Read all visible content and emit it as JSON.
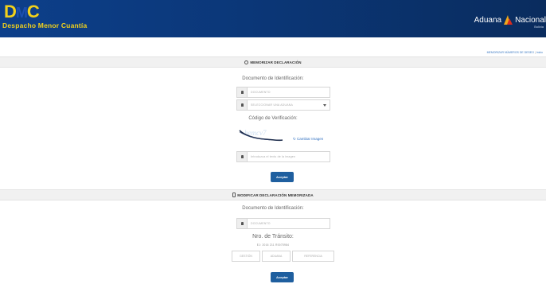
{
  "header": {
    "logo_letters": [
      "D",
      "M",
      "C"
    ],
    "logo_subtitle": "Despacho Menor Cuantía",
    "brand_text": "Aduana Nacional",
    "brand_sub": "Bolivia"
  },
  "top_link": {
    "text": "MEMORIZAR NÚMEROS DE DESEO",
    "extra": "Inicio"
  },
  "section1": {
    "title": "MEMORIZAR DECLARACIÓN",
    "doc_label": "Documento de Identificación:",
    "doc_placeholder": "DOCUMENTO",
    "select_value": "SELECCIONAR UNA ADUANA",
    "captcha_label": "Código de Verificación:",
    "refresh_label": "Cambiar Imagen",
    "captcha_placeholder": "Introduzca el texto de la imagen",
    "button": "Aceptar"
  },
  "section2": {
    "title": "MODIFICAR DECLARACIÓN MEMORIZADA",
    "doc_label": "Documento de Identificación:",
    "doc_placeholder": "DOCUMENTO",
    "transit_label": "Nro. de Tránsito:",
    "transit_hint": "EJ: 2016 211 R0075984",
    "gestion_placeholder": "GESTIÓN",
    "aduana_placeholder": "ADUANA",
    "referencia_placeholder": "REFERENCIA",
    "button": "Aceptar"
  },
  "colors": {
    "header_bg": "#0b3778",
    "logo_yellow": "#f2d11a",
    "button_blue": "#1f5f9f",
    "link_blue": "#3b79c2"
  }
}
